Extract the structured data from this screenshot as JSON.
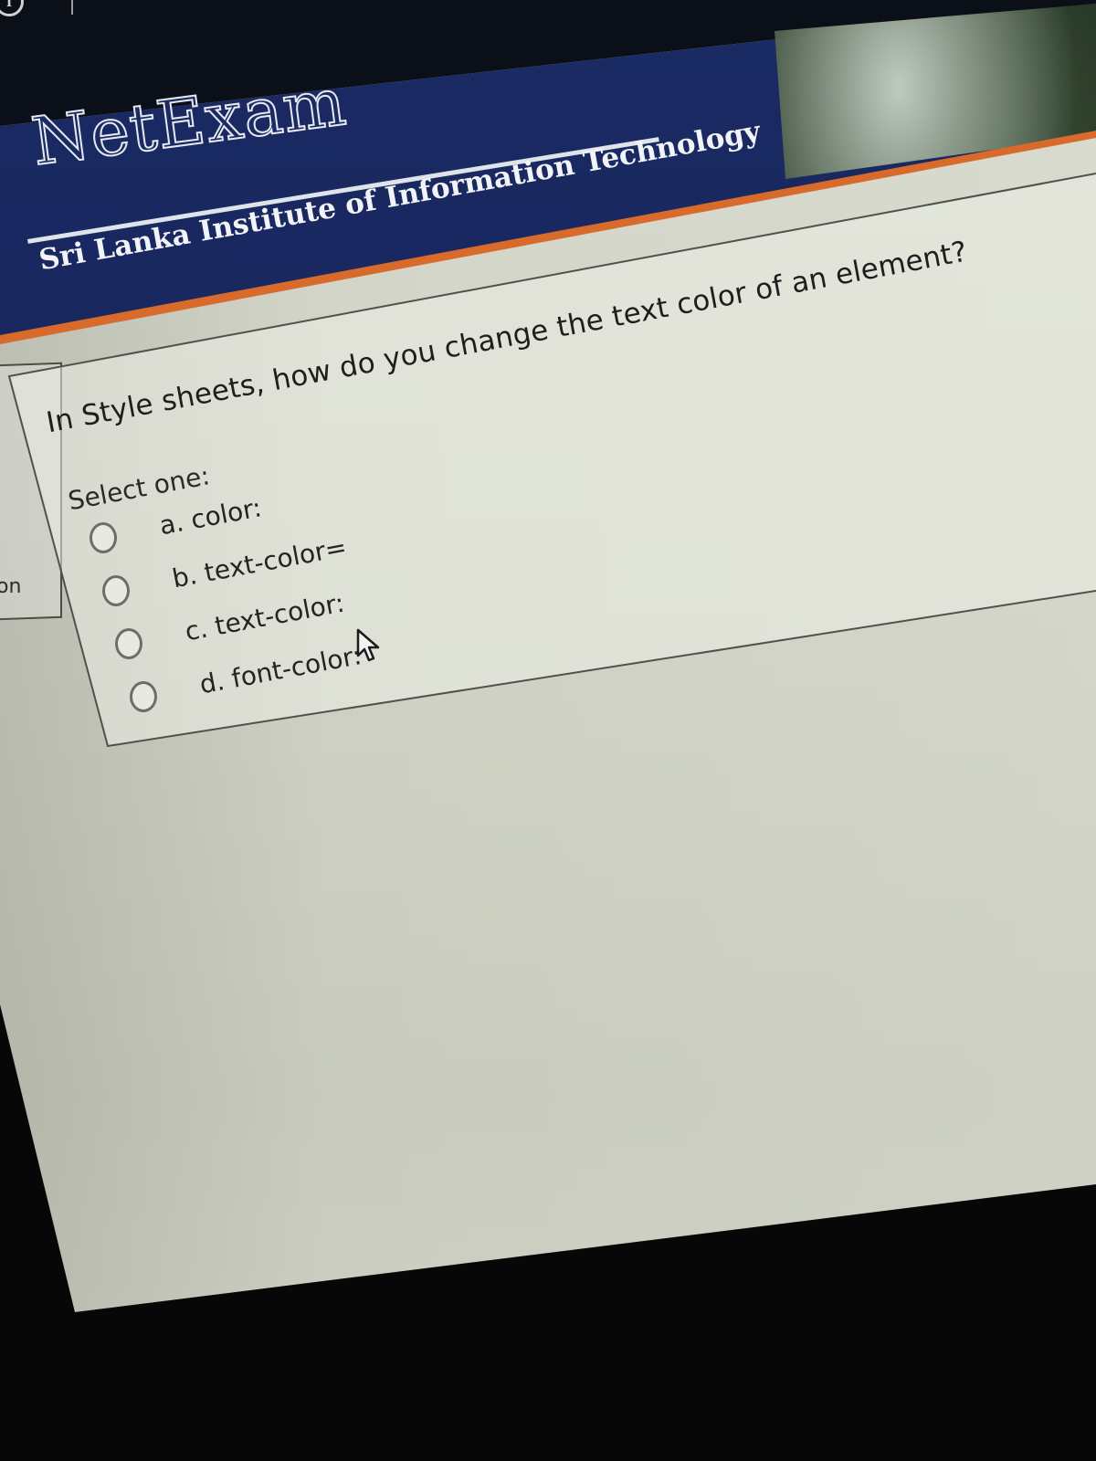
{
  "header": {
    "brand_title": "NetExam",
    "institute": "Sri Lanka Institute of Information Technology"
  },
  "nav": {
    "partial_label": "on"
  },
  "question": {
    "text": "In Style sheets, how do you change the text color of an element?",
    "prompt": "Select one:",
    "options": [
      {
        "label": "a. color:"
      },
      {
        "label": "b. text-color="
      },
      {
        "label": "c. text-color:"
      },
      {
        "label": "d. font-color:"
      }
    ]
  },
  "colors": {
    "banner_navy": "#1a2a63",
    "accent_orange": "#d86a2c",
    "page_background": "#d2d5c8"
  },
  "icons": [
    "info-icon",
    "mouse-pointer-icon"
  ]
}
